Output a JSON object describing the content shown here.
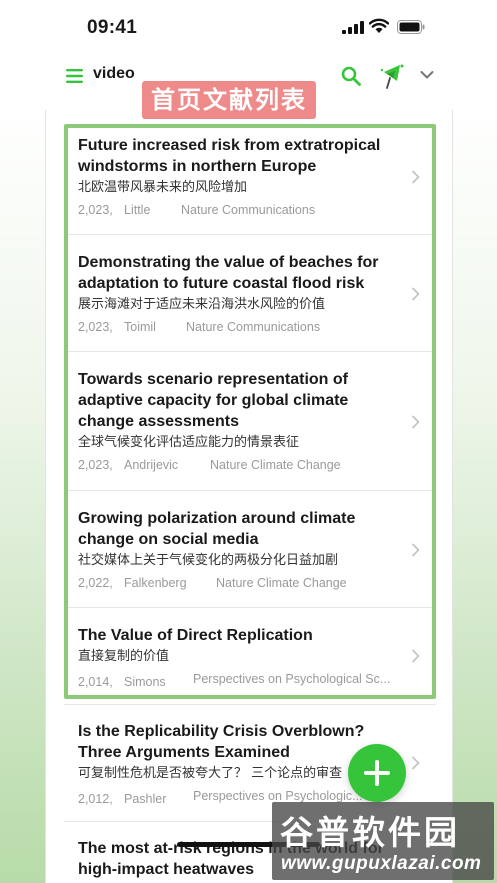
{
  "status_bar": {
    "time": "09:41"
  },
  "header": {
    "project_title": "video",
    "section_label": "首页文献列表"
  },
  "papers": [
    {
      "title": "Future increased risk from extratropical windstorms in northern Europe",
      "title_cn": "北欧温带风暴未来的风险增加",
      "year": "2,023,",
      "author": "Little",
      "journal": "Nature Communications"
    },
    {
      "title": "Demonstrating the value of beaches for adaptation to future coastal flood risk",
      "title_cn": "展示海滩对于适应未来沿海洪水风险的价值",
      "year": "2,023,",
      "author": "Toimil",
      "journal": "Nature Communications"
    },
    {
      "title": "Towards scenario representation of adaptive capacity for global climate change assessments",
      "title_cn": "全球气候变化评估适应能力的情景表征",
      "year": "2,023,",
      "author": "Andrijevic",
      "journal": "Nature Climate Change"
    },
    {
      "title": "Growing polarization around climate change on social media",
      "title_cn": "社交媒体上关于气候变化的两极分化日益加剧",
      "year": "2,022,",
      "author": "Falkenberg",
      "journal": "Nature Climate Change"
    },
    {
      "title": "The Value of Direct Replication",
      "title_cn": "直接复制的价值",
      "year": "2,014,",
      "author": "Simons",
      "journal": "Perspectives on Psychological Sc..."
    },
    {
      "title": "Is the Replicability Crisis Overblown? Three Arguments Examined",
      "title_cn": "可复制性危机是否被夸大了？ 三个论点的审查",
      "year": "2,012,",
      "author": "Pashler",
      "journal": "Perspectives on Psychologic..."
    },
    {
      "title": "The most at-risk regions in the world for high-impact heatwaves",
      "title_cn": "",
      "year": "",
      "author": "",
      "journal": ""
    }
  ],
  "watermark": {
    "main": "谷普软件园",
    "url": "www.gupuxlazai.com"
  },
  "colors": {
    "accent_green": "#35c43a",
    "highlight_border": "#8cca78",
    "label_bg": "#ef8a8a",
    "meta_gray": "#9a9a9a"
  },
  "icons": [
    "menu-icon",
    "search-icon",
    "broadcast-icon",
    "chevron-down-icon",
    "chevron-right-icon",
    "plus-icon"
  ]
}
